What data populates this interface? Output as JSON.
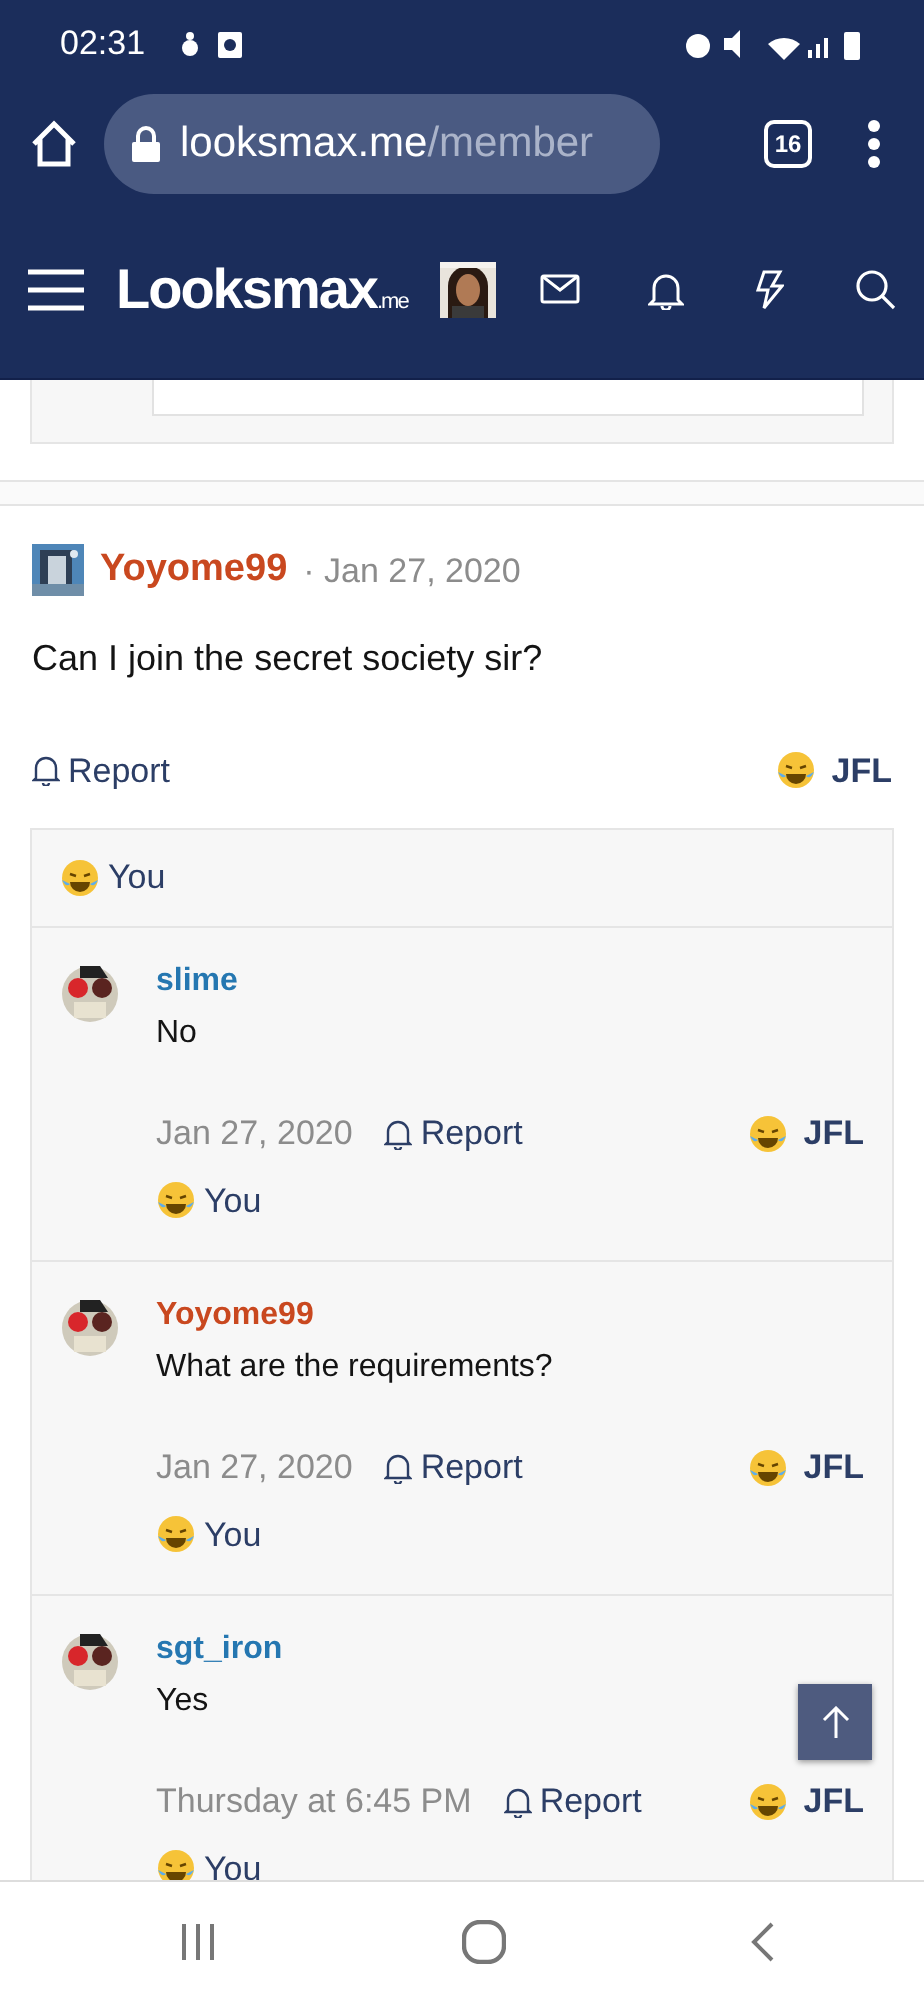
{
  "status_bar": {
    "time": "02:31"
  },
  "browser": {
    "url_host": "looksmax.me",
    "url_path": "/member",
    "tab_count": "16"
  },
  "site_header": {
    "logo_main": "Looksmax",
    "logo_suffix": ".me"
  },
  "post": {
    "author": "Yoyome99",
    "color": "#c9481f",
    "separator": "·",
    "date": "Jan 27, 2020",
    "body": "Can I join the secret society sir?",
    "report": "Report",
    "reaction": "JFL",
    "reacted_by": "You"
  },
  "comments": [
    {
      "author": "slime",
      "color": "#2577b1",
      "body": "No",
      "date": "Jan 27, 2020",
      "report": "Report",
      "reaction": "JFL",
      "reacted_by": "You"
    },
    {
      "author": "Yoyome99",
      "color": "#c9481f",
      "body": "What are the requirements?",
      "date": "Jan 27, 2020",
      "report": "Report",
      "reaction": "JFL",
      "reacted_by": "You"
    },
    {
      "author": "sgt_iron",
      "color": "#2577b1",
      "body": "Yes",
      "date": "Thursday at 6:45 PM",
      "report": "Report",
      "reaction": "JFL",
      "reacted_by": "You"
    }
  ]
}
